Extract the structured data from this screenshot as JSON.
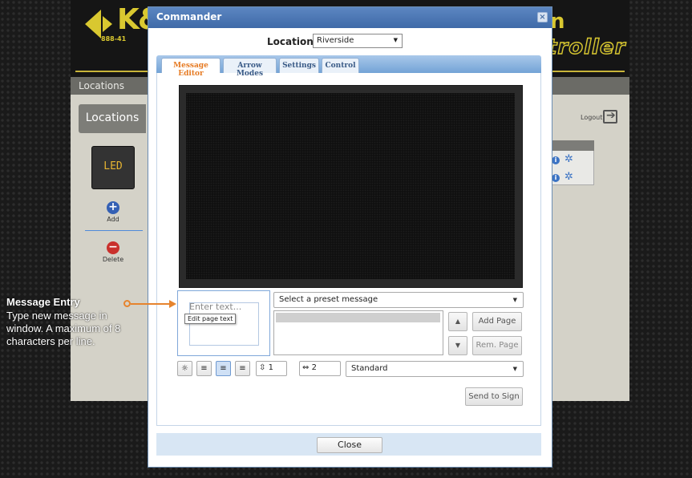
{
  "background_app": {
    "logo_text": "K&",
    "phone_partial": "888-41",
    "title_partial_1": "n",
    "title_partial_2": "troller",
    "nav_locations": "Locations",
    "sidebar_heading": "Locations",
    "led_label": "LED",
    "add_label": "Add",
    "delete_label": "Delete",
    "logout_label": "Logout"
  },
  "modal": {
    "title": "Commander",
    "close_x": "×",
    "location_label": "Location",
    "location_value": "Riverside",
    "tabs": [
      {
        "label": "Message Editor",
        "active": true
      },
      {
        "label": "Arrow Modes",
        "active": false
      },
      {
        "label": "Settings",
        "active": false
      },
      {
        "label": "Control",
        "active": false
      }
    ],
    "entry_placeholder": "Enter text...",
    "entry_tooltip": "Edit page text",
    "preset_placeholder": "Select a preset message",
    "page_up_icon": "▲",
    "page_down_icon": "▼",
    "add_page_label": "Add Page",
    "rem_page_label": "Rem. Page",
    "line_spacing_value": "1",
    "char_spacing_value": "2",
    "font_value": "Standard",
    "send_label": "Send to Sign",
    "close_label": "Close"
  },
  "callout": {
    "title": "Message Entry",
    "body": "Type new message in window. A maximum of 8 characters per line."
  },
  "colors": {
    "accent_orange": "#e6842e",
    "dialog_blue": "#3f6aa8",
    "brand_yellow": "#d9c830"
  },
  "icons": [
    "plus-circle-icon",
    "minus-circle-icon",
    "logout-icon",
    "info-icon",
    "gear-icon",
    "invert-icon",
    "align-left-icon",
    "align-center-icon",
    "align-right-icon",
    "line-spacing-icon",
    "char-spacing-icon"
  ]
}
